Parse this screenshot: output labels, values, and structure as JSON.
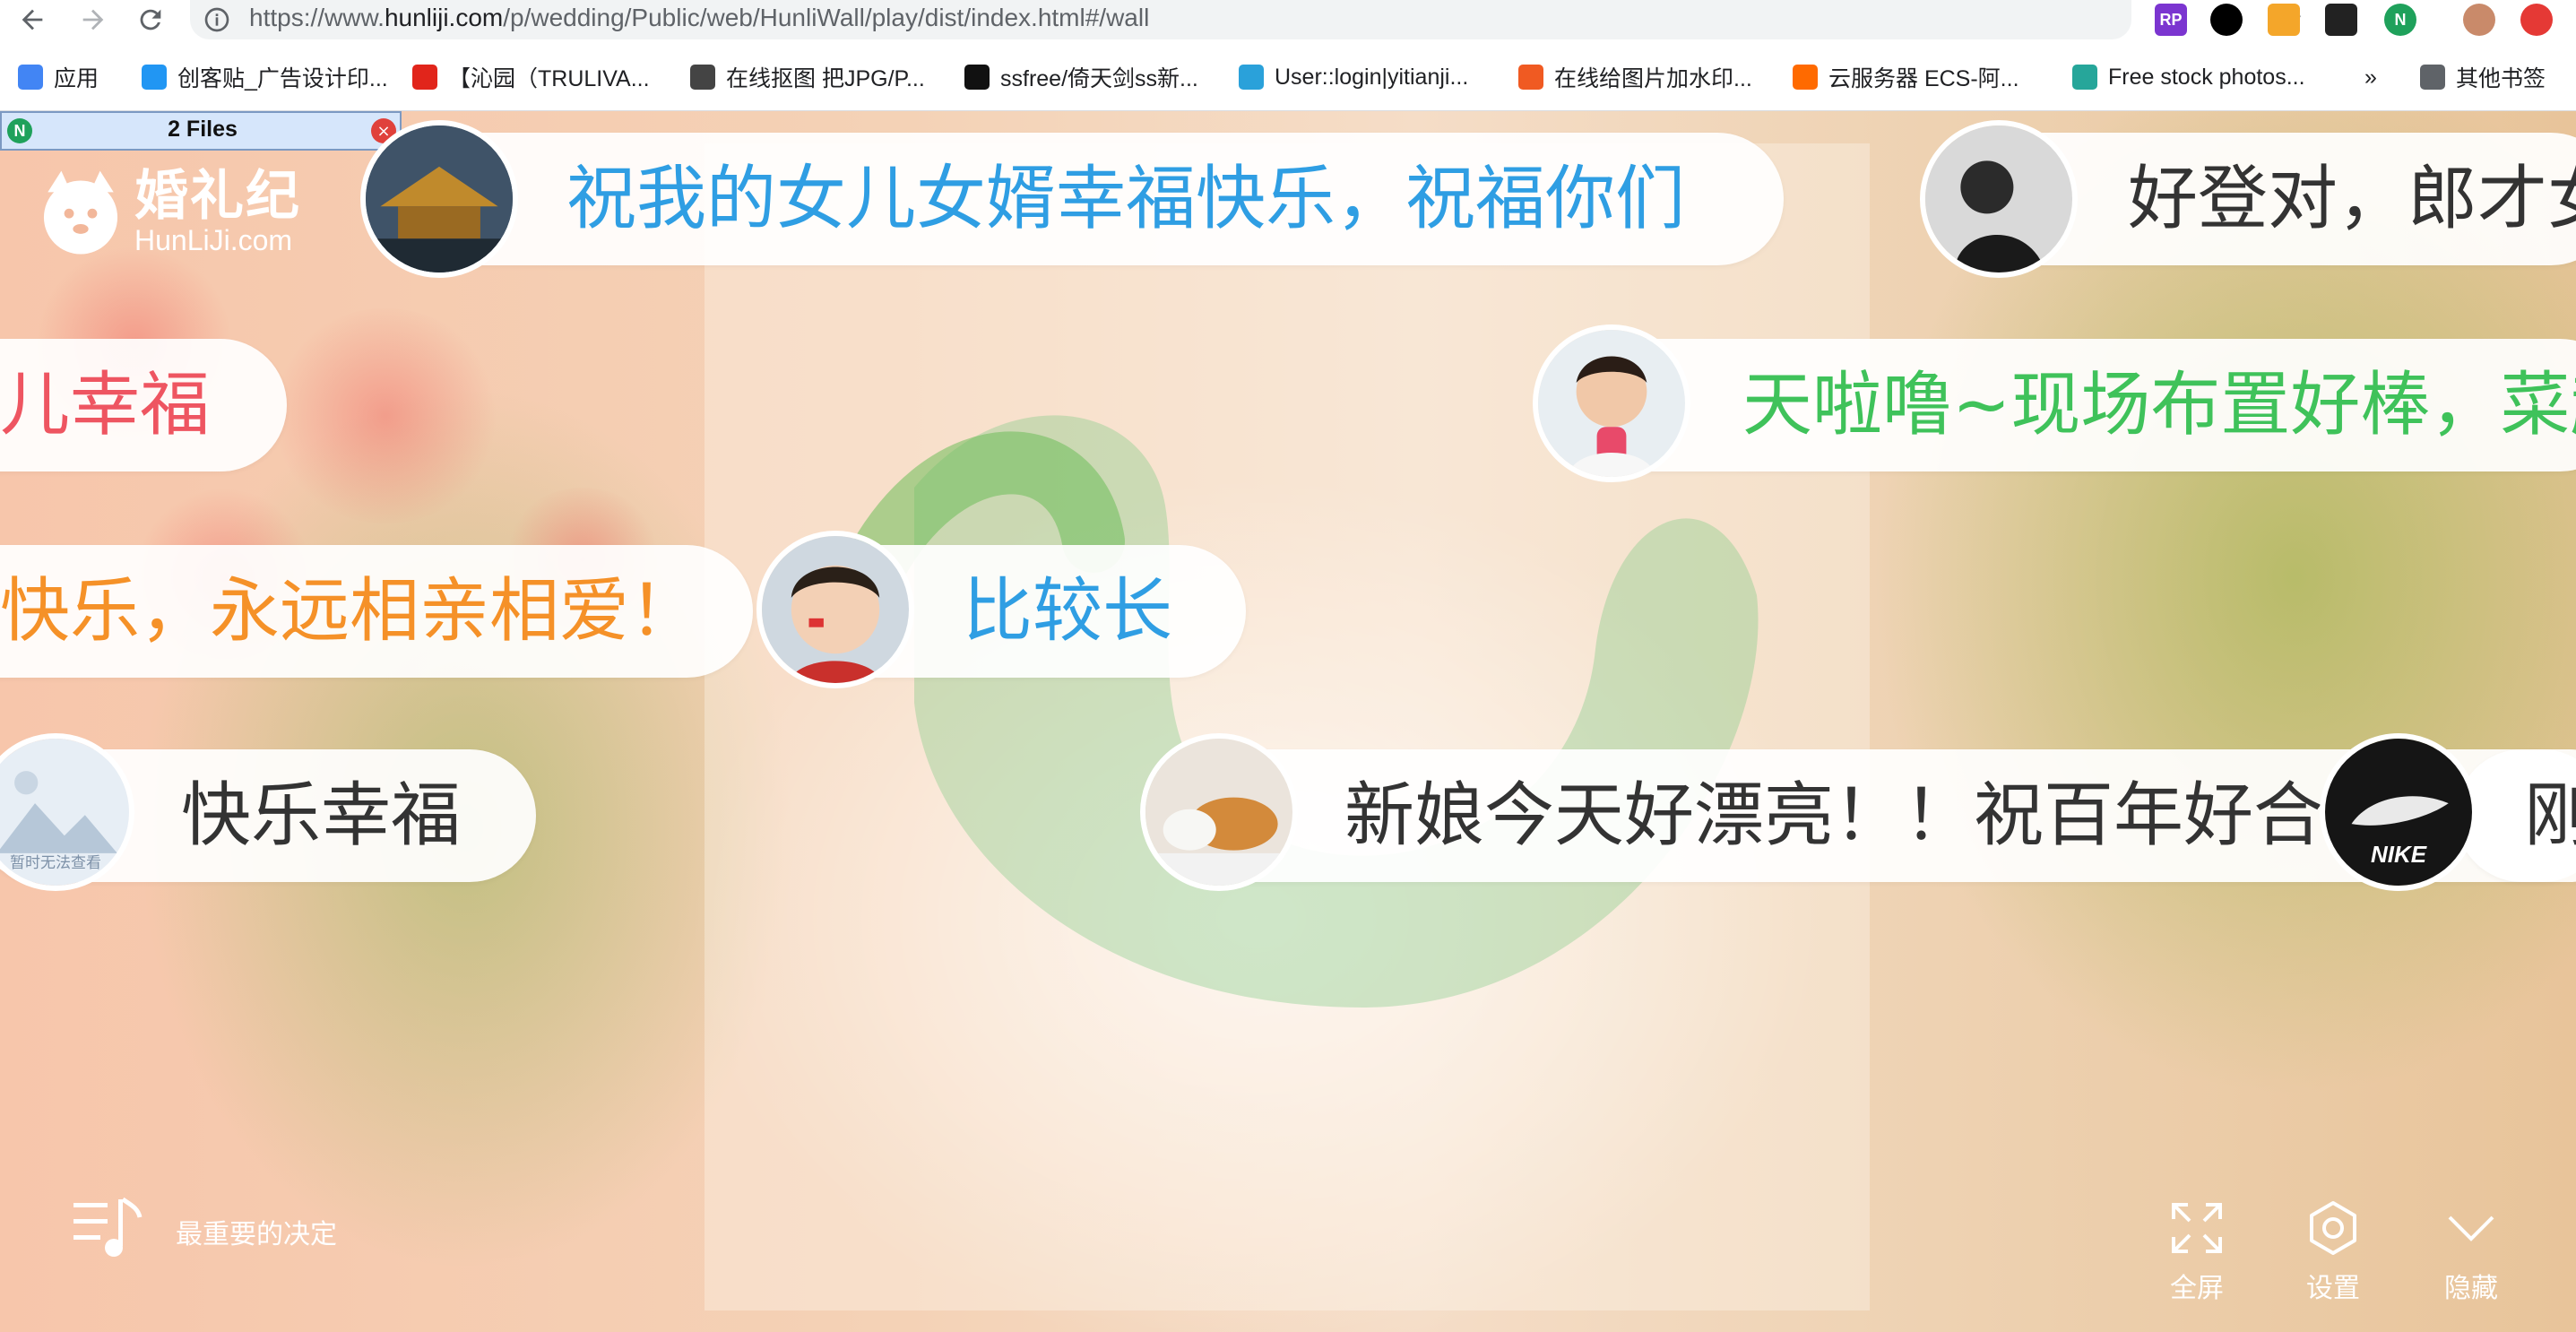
{
  "browser": {
    "url_prefix": "https://www.",
    "url_domain": "hunliji.com",
    "url_path": "/p/wedding/Public/web/HunliWall/play/dist/index.html#/wall",
    "extensions": [
      {
        "name": "axure-rp-extension",
        "label": "RP",
        "color": "#7b35d0"
      },
      {
        "name": "record-extension",
        "label": "",
        "color": "#000000"
      },
      {
        "name": "color-grid-extension",
        "label": "",
        "color": "#f4a62a"
      },
      {
        "name": "dark-mode-extension",
        "label": "",
        "color": "#222222"
      },
      {
        "name": "n-extension",
        "label": "N",
        "color": "#1fa15b"
      },
      {
        "name": "profile-avatar",
        "label": "",
        "color": "#c98a6a"
      },
      {
        "name": "red-arrow-extension",
        "label": "",
        "color": "#e53935"
      }
    ]
  },
  "bookmarks": {
    "items": [
      {
        "label": "应用",
        "icon": "apps-grid-icon",
        "color": "#4285f4"
      },
      {
        "label": "创客贴_广告设计印...",
        "icon": "chuangketie-icon",
        "color": "#2196f3"
      },
      {
        "label": "【沁园（TRULIVA...",
        "icon": "jd-icon",
        "color": "#e1251b"
      },
      {
        "label": "在线抠图 把JPG/P...",
        "icon": "globe-icon",
        "color": "#444444"
      },
      {
        "label": "ssfree/倚天剑ss新...",
        "icon": "github-icon",
        "color": "#111111"
      },
      {
        "label": "User::login|yitianji...",
        "icon": "telegram-icon",
        "color": "#2aa1da"
      },
      {
        "label": "在线给图片加水印...",
        "icon": "watermark-icon",
        "color": "#f05a22"
      },
      {
        "label": "云服务器 ECS-阿...",
        "icon": "aliyun-icon",
        "color": "#ff6a00"
      },
      {
        "label": "Free stock photos...",
        "icon": "pexels-icon",
        "color": "#26a69a"
      }
    ],
    "overflow_label": "»",
    "other_label": "其他书签"
  },
  "files_bar": {
    "count_label": "2 Files",
    "badge": "N",
    "close": "×"
  },
  "logo": {
    "cn": "婚礼纪",
    "en": "HunLiJi.com"
  },
  "messages": [
    {
      "id": "m1",
      "text": "祝我的女儿女婿幸福快乐，祝福你们",
      "color": "#2f9ee3",
      "avatar": "palace-photo"
    },
    {
      "id": "m2",
      "text": "好登对，郎才女貌",
      "color": "#333333",
      "avatar": "bw-portrait"
    },
    {
      "id": "m3",
      "text": "儿幸福",
      "color": "#ee5561",
      "avatar": ""
    },
    {
      "id": "m4",
      "text": "天啦噜~现场布置好棒，菜超好吃",
      "color": "#3fc25a",
      "avatar": "child-eating"
    },
    {
      "id": "m5",
      "text": "快乐，永远相亲相爱！",
      "color": "#f59128",
      "avatar": ""
    },
    {
      "id": "m6",
      "text": "比较长",
      "color": "#2f9ee3",
      "avatar": "child-facepaint"
    },
    {
      "id": "m7",
      "text": "快乐幸福",
      "color": "#333333",
      "avatar": "placeholder",
      "avatar_caption": "暂时无法查看"
    },
    {
      "id": "m8",
      "text": "新娘今天好漂亮！！祝百年好合",
      "color": "#333333",
      "avatar": "sleeping-dog"
    },
    {
      "id": "m9",
      "text": "刚",
      "color": "#333333",
      "avatar": "nike-shoe",
      "avatar_caption": "NIKE"
    }
  ],
  "player": {
    "song": "最重要的决定"
  },
  "controls": {
    "fullscreen": "全屏",
    "settings": "设置",
    "hide": "隐藏"
  },
  "colors": {
    "blue": "#2f9ee3",
    "green": "#3fc25a",
    "orange": "#f59128",
    "red": "#ee5561"
  }
}
